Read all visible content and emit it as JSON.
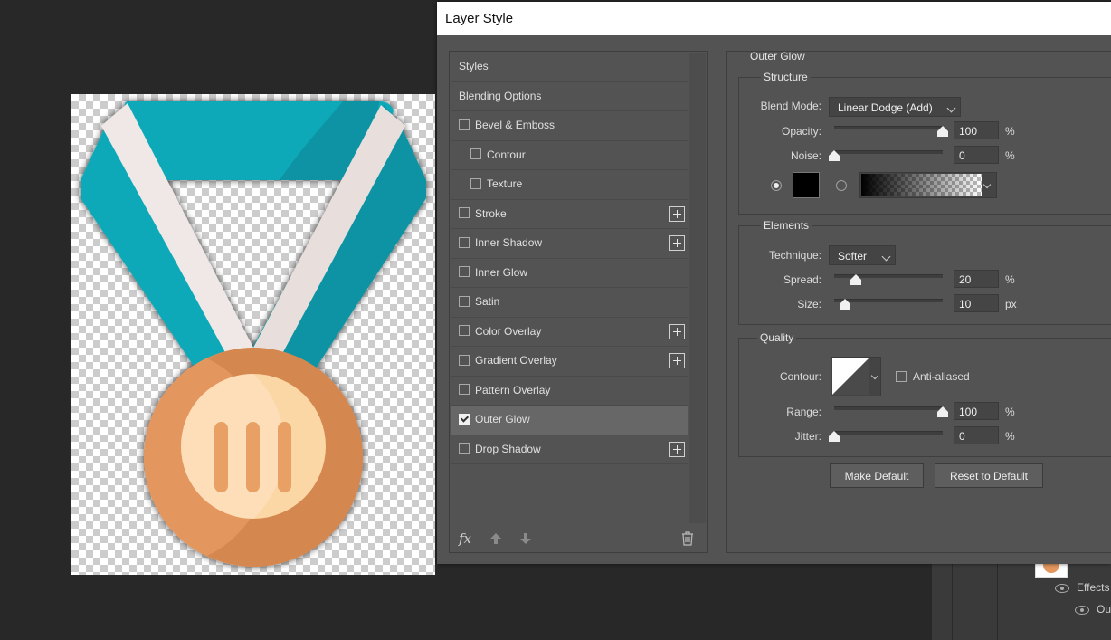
{
  "dialog": {
    "title": "Layer Style"
  },
  "sidebar": {
    "items": [
      {
        "label": "Styles",
        "checkbox": false,
        "checked": false,
        "plus": false,
        "indent": false,
        "selected": false
      },
      {
        "label": "Blending Options",
        "checkbox": false,
        "checked": false,
        "plus": false,
        "indent": false,
        "selected": false
      },
      {
        "label": "Bevel & Emboss",
        "checkbox": true,
        "checked": false,
        "plus": false,
        "indent": false,
        "selected": false
      },
      {
        "label": "Contour",
        "checkbox": true,
        "checked": false,
        "plus": false,
        "indent": true,
        "selected": false
      },
      {
        "label": "Texture",
        "checkbox": true,
        "checked": false,
        "plus": false,
        "indent": true,
        "selected": false
      },
      {
        "label": "Stroke",
        "checkbox": true,
        "checked": false,
        "plus": true,
        "indent": false,
        "selected": false
      },
      {
        "label": "Inner Shadow",
        "checkbox": true,
        "checked": false,
        "plus": true,
        "indent": false,
        "selected": false
      },
      {
        "label": "Inner Glow",
        "checkbox": true,
        "checked": false,
        "plus": false,
        "indent": false,
        "selected": false
      },
      {
        "label": "Satin",
        "checkbox": true,
        "checked": false,
        "plus": false,
        "indent": false,
        "selected": false
      },
      {
        "label": "Color Overlay",
        "checkbox": true,
        "checked": false,
        "plus": true,
        "indent": false,
        "selected": false
      },
      {
        "label": "Gradient Overlay",
        "checkbox": true,
        "checked": false,
        "plus": true,
        "indent": false,
        "selected": false
      },
      {
        "label": "Pattern Overlay",
        "checkbox": true,
        "checked": false,
        "plus": false,
        "indent": false,
        "selected": false
      },
      {
        "label": "Outer Glow",
        "checkbox": true,
        "checked": true,
        "plus": false,
        "indent": false,
        "selected": true
      },
      {
        "label": "Drop Shadow",
        "checkbox": true,
        "checked": false,
        "plus": true,
        "indent": false,
        "selected": false
      }
    ],
    "fx_label": "fx"
  },
  "outer_glow": {
    "title": "Outer Glow",
    "structure": {
      "title": "Structure",
      "blend_mode_label": "Blend Mode:",
      "blend_mode_value": "Linear Dodge (Add)",
      "opacity_label": "Opacity:",
      "opacity_value": "100",
      "opacity_level": 1.0,
      "opacity_unit": "%",
      "noise_label": "Noise:",
      "noise_value": "0",
      "noise_level": 0.0,
      "noise_unit": "%",
      "color": "#000000",
      "color_mode": "solid"
    },
    "elements": {
      "title": "Elements",
      "technique_label": "Technique:",
      "technique_value": "Softer",
      "spread_label": "Spread:",
      "spread_value": "20",
      "spread_level": 0.2,
      "spread_unit": "%",
      "size_label": "Size:",
      "size_value": "10",
      "size_level": 0.1,
      "size_unit": "px"
    },
    "quality": {
      "title": "Quality",
      "contour_label": "Contour:",
      "anti_aliased_label": "Anti-aliased",
      "anti_aliased": false,
      "range_label": "Range:",
      "range_value": "100",
      "range_level": 1.0,
      "range_unit": "%",
      "jitter_label": "Jitter:",
      "jitter_value": "0",
      "jitter_level": 0.0,
      "jitter_unit": "%"
    },
    "buttons": {
      "make_default": "Make Default",
      "reset_default": "Reset to Default"
    }
  },
  "layers_panel": {
    "effects_label": "Effects",
    "outer_glow_label": "Out"
  },
  "colors": {
    "ribbon_teal": "#0fa9b9",
    "ribbon_teal_dark": "#0b93a3",
    "ribbon_white": "#f0e8e6",
    "medal_outer": "#e3965d",
    "medal_outer_dark": "#d4874f",
    "medal_inner": "#fcd7a6",
    "medal_bars": "#e8a065"
  }
}
